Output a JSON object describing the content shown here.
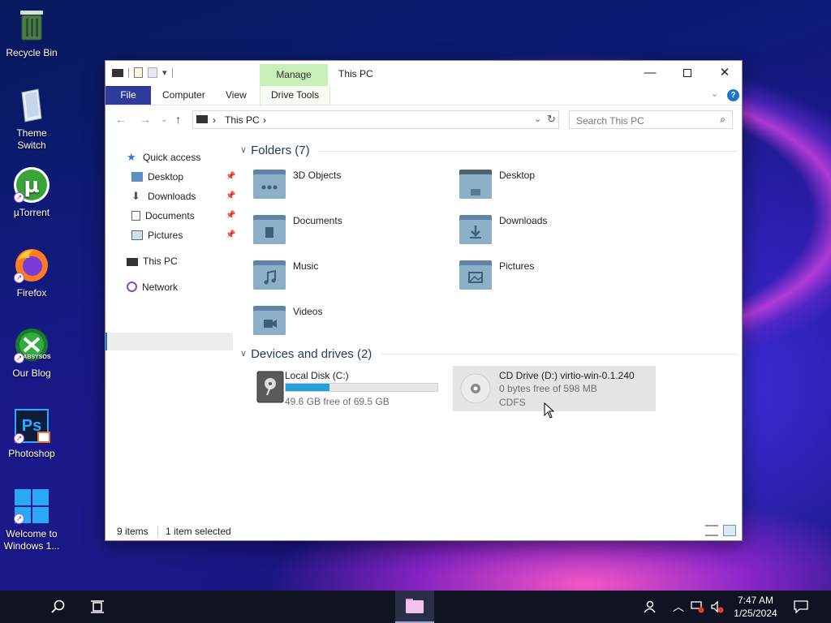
{
  "desktop": {
    "icons": [
      {
        "label": "Recycle Bin",
        "icon": "recycle-bin-icon"
      },
      {
        "label": "Theme Switch",
        "icon": "theme-switch-icon"
      },
      {
        "label": "µTorrent",
        "icon": "utorrent-icon"
      },
      {
        "label": "Firefox",
        "icon": "firefox-icon"
      },
      {
        "label": "Our Blog",
        "icon": "labsysos-icon",
        "logo_text": "LABSYSOS"
      },
      {
        "label": "Photoshop",
        "icon": "photoshop-icon",
        "logo_text": "Ps"
      },
      {
        "label": "Welcome to Windows 1...",
        "icon": "windows-logo-icon"
      }
    ]
  },
  "window": {
    "title": "This PC",
    "manage_tab": "Manage",
    "ribbon_tabs": [
      "File",
      "Computer",
      "View",
      "Drive Tools"
    ],
    "help_glyph": "?",
    "address": {
      "crumbs": [
        "This PC"
      ]
    },
    "search": {
      "placeholder": "Search This PC"
    },
    "sidebar": {
      "quick_access": "Quick access",
      "quick_items": [
        "Desktop",
        "Downloads",
        "Documents",
        "Pictures"
      ],
      "this_pc": "This PC",
      "network": "Network"
    },
    "folders_header": "Folders (7)",
    "folders": [
      "3D Objects",
      "Desktop",
      "Documents",
      "Downloads",
      "Music",
      "Pictures",
      "Videos"
    ],
    "devices_header": "Devices and drives (2)",
    "drives": [
      {
        "name": "Local Disk (C:)",
        "free": "49.6 GB free of 69.5 GB",
        "used_fraction": 0.29
      },
      {
        "name": "CD Drive (D:) virtio-win-0.1.240",
        "free": "0 bytes free of 598 MB",
        "fs": "CDFS"
      }
    ],
    "status": {
      "items": "9 items",
      "selected": "1 item selected"
    }
  },
  "taskbar": {
    "time": "7:47 AM",
    "date": "1/25/2024"
  },
  "colors": {
    "accent": "#1f76c9",
    "file_tab": "#2f3b9c",
    "manage_tab": "#c9efb9",
    "drive_bar": "#26a0da",
    "taskbar": "#101322"
  }
}
